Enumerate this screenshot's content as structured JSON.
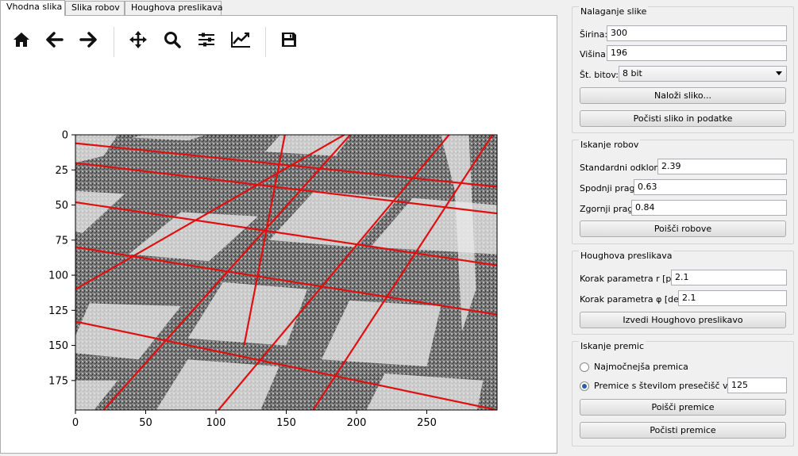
{
  "tabs": [
    {
      "label": "Vhodna slika",
      "active": true
    },
    {
      "label": "Slika robov",
      "active": false
    },
    {
      "label": "Houghova preslikava",
      "active": false
    }
  ],
  "toolbar": {
    "icons": [
      "home-icon",
      "back-arrow-icon",
      "forward-arrow-icon",
      "pan-icon",
      "zoom-icon",
      "configure-subplots-icon",
      "edit-axis-icon",
      "save-icon"
    ]
  },
  "plot": {
    "x_ticks": [
      "0",
      "50",
      "100",
      "150",
      "200",
      "250"
    ],
    "y_ticks": [
      "0",
      "25",
      "50",
      "75",
      "100",
      "125",
      "150",
      "175"
    ],
    "x_range": [
      0,
      300
    ],
    "y_range": [
      0,
      196
    ],
    "line_color": "#e01010"
  },
  "image_group": {
    "title": "Nalaganje slike",
    "width_label": "Širina:",
    "width_value": "300",
    "height_label": "Višina:",
    "height_value": "196",
    "bits_label": "Št. bitov:",
    "bits_value": "8 bit",
    "load_button": "Naloži sliko...",
    "clear_button": "Počisti sliko in podatke"
  },
  "edge_group": {
    "title": "Iskanje robov",
    "std_label": "Standardni odklon:",
    "std_value": "2.39",
    "low_label": "Spodnji prag:",
    "low_value": "0.63",
    "high_label": "Zgornji prag:",
    "high_value": "0.84",
    "find_button": "Poišči robove"
  },
  "hough_group": {
    "title": "Houghova preslikava",
    "r_label": "Korak parametra r [px]",
    "r_value": "2.1",
    "phi_label": "Korak parametra φ [deg]",
    "phi_value": "2.1",
    "run_button": "Izvedi Houghovo preslikavo"
  },
  "lines_group": {
    "title": "Iskanje premic",
    "strongest_label": "Najmočnejša premica",
    "strongest_checked": false,
    "threshold_label": "Premice s številom presečišč vsaj",
    "threshold_checked": true,
    "threshold_value": "125",
    "find_button": "Poišči premice",
    "clear_button": "Počisti premice"
  }
}
